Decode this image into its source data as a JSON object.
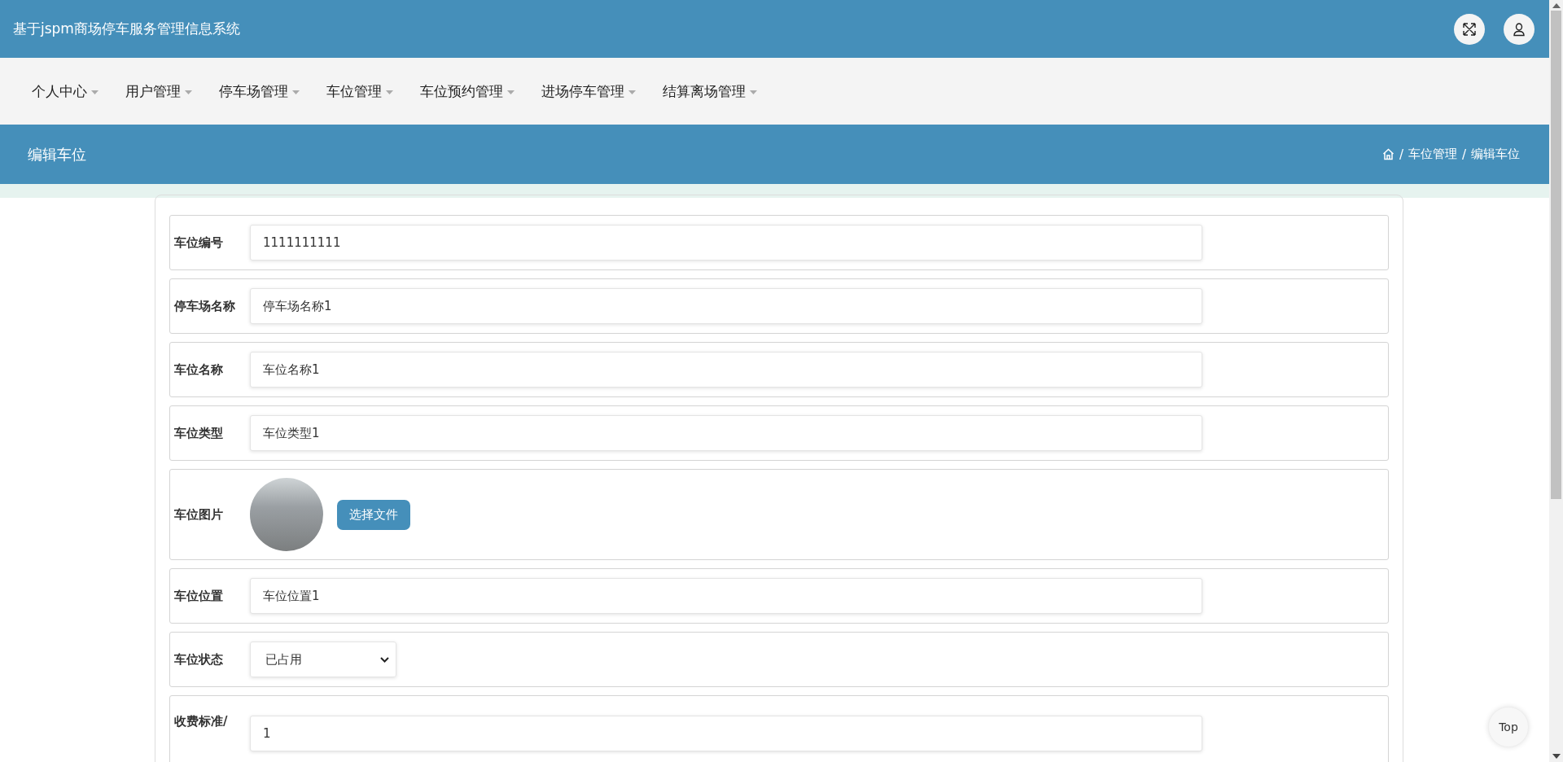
{
  "header": {
    "title": "基于jspm商场停车服务管理信息系统"
  },
  "nav": [
    {
      "label": "个人中心"
    },
    {
      "label": "用户管理"
    },
    {
      "label": "停车场管理"
    },
    {
      "label": "车位管理"
    },
    {
      "label": "车位预约管理"
    },
    {
      "label": "进场停车管理"
    },
    {
      "label": "结算离场管理"
    }
  ],
  "page_title": "编辑车位",
  "breadcrumb": [
    "车位管理",
    "编辑车位"
  ],
  "breadcrumb_separator": "/",
  "form": [
    {
      "kind": "text",
      "label": "车位编号",
      "value": "1111111111"
    },
    {
      "kind": "text",
      "label": "停车场名称",
      "value": "停车场名称1"
    },
    {
      "kind": "text",
      "label": "车位名称",
      "value": "车位名称1"
    },
    {
      "kind": "text",
      "label": "车位类型",
      "value": "车位类型1"
    },
    {
      "kind": "image",
      "label": "车位图片",
      "button": "选择文件"
    },
    {
      "kind": "text",
      "label": "车位位置",
      "value": "车位位置1"
    },
    {
      "kind": "select",
      "label": "车位状态",
      "value": "已占用"
    },
    {
      "kind": "wrapped_text",
      "label": "收费标准/",
      "value": "1"
    }
  ],
  "top_button": "Top"
}
